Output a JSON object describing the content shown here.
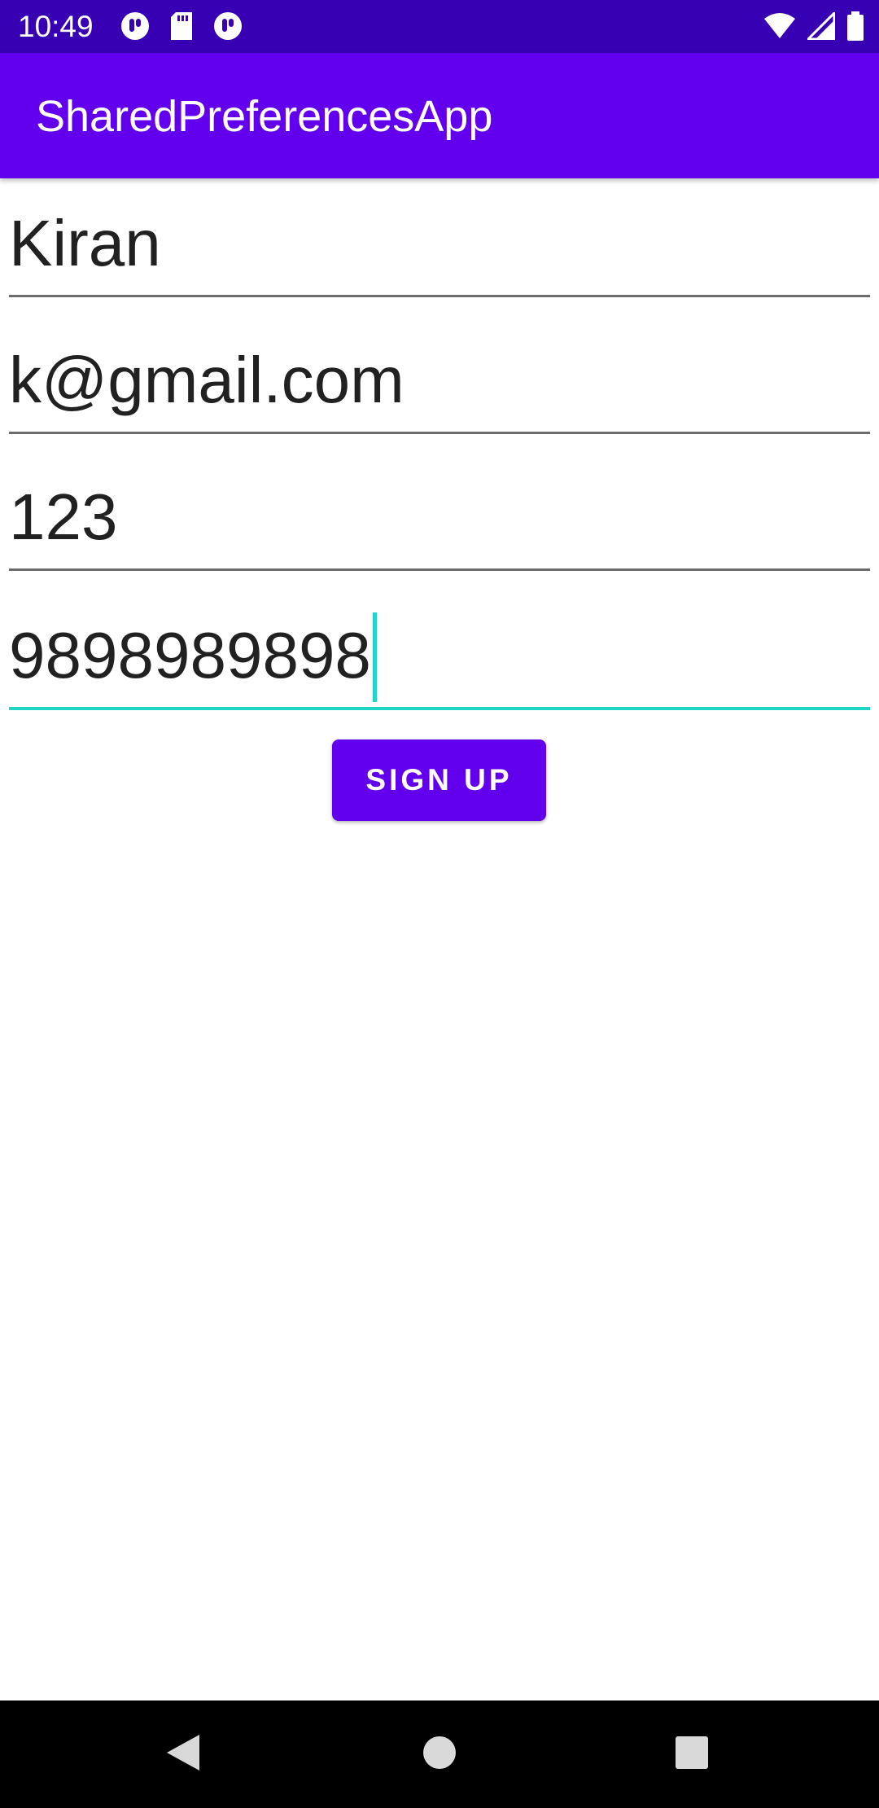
{
  "status_bar": {
    "time": "10:49",
    "left_icons": [
      "notification-icon",
      "sd-card-icon",
      "notification-icon"
    ],
    "right_icons": [
      "wifi-icon",
      "cellular-signal-icon",
      "battery-icon"
    ]
  },
  "app_bar": {
    "title": "SharedPreferencesApp"
  },
  "form": {
    "name_value": "Kiran",
    "email_value": "k@gmail.com",
    "password_value": "123",
    "phone_value": "9898989898",
    "signup_label": "SIGN UP"
  },
  "nav_bar": {
    "buttons": [
      "back-icon",
      "home-icon",
      "recents-icon"
    ]
  },
  "colors": {
    "status_bar": "#3700b3",
    "primary": "#6200ee",
    "focus_accent": "#1fd6c6",
    "nav_bar": "#000000"
  }
}
